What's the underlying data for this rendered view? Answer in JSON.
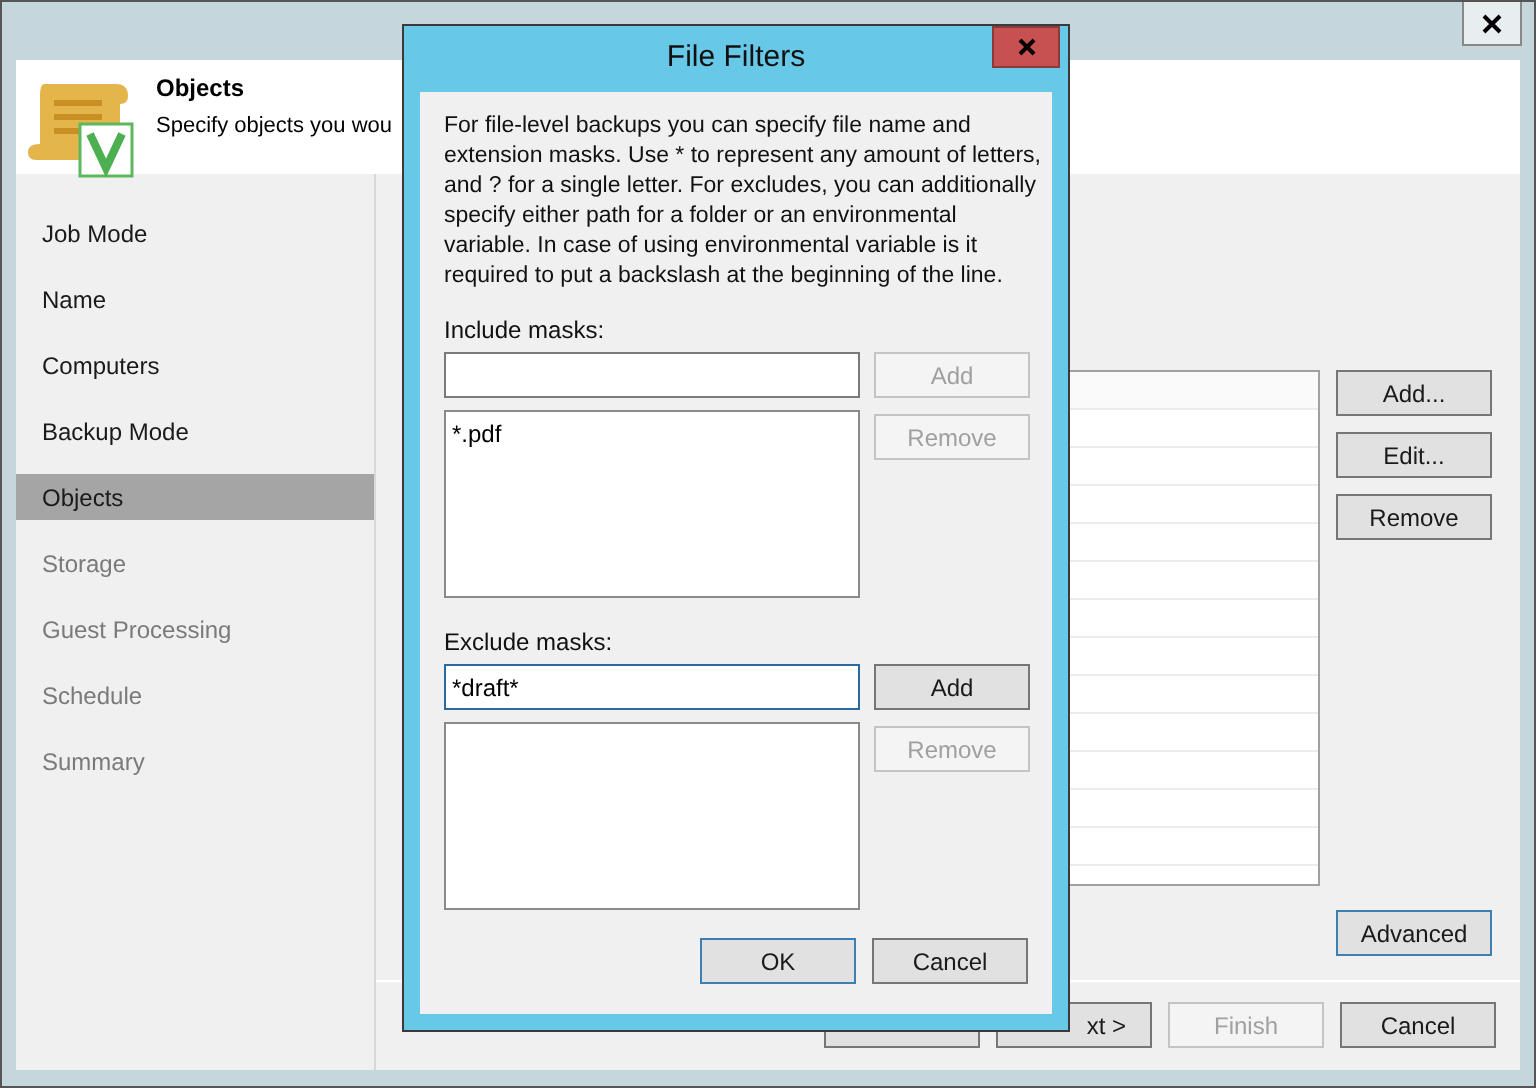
{
  "header": {
    "title": "Objects",
    "subtitle": "Specify objects you wou"
  },
  "nav": [
    {
      "label": "Job Mode",
      "selected": false,
      "disabled": false
    },
    {
      "label": "Name",
      "selected": false,
      "disabled": false
    },
    {
      "label": "Computers",
      "selected": false,
      "disabled": false
    },
    {
      "label": "Backup Mode",
      "selected": false,
      "disabled": false
    },
    {
      "label": "Objects",
      "selected": true,
      "disabled": false
    },
    {
      "label": "Storage",
      "selected": false,
      "disabled": true
    },
    {
      "label": "Guest Processing",
      "selected": false,
      "disabled": true
    },
    {
      "label": "Schedule",
      "selected": false,
      "disabled": true
    },
    {
      "label": "Summary",
      "selected": false,
      "disabled": true
    }
  ],
  "object_buttons": [
    {
      "label": "Add...",
      "disabled": false
    },
    {
      "label": "Edit...",
      "disabled": false
    },
    {
      "label": "Remove",
      "disabled": false
    }
  ],
  "advanced_button": {
    "label": "Advanced",
    "default": true
  },
  "footer_buttons": [
    {
      "disabled": false
    },
    {
      "label": "xt >",
      "disabled": false
    },
    {
      "label": "Finish",
      "disabled": true
    },
    {
      "label": "Cancel",
      "disabled": false
    }
  ],
  "dialog": {
    "title": "File Filters",
    "description": "For file-level backups you can specify file name and extension masks. Use * to represent any amount of letters, and ? for a single letter. For excludes, you can additionally specify either path for a folder or an environmental variable. In case of using environmental variable is it required to put a backslash at the beginning of the line.",
    "sections": [
      {
        "label": "Include masks:",
        "focused": false,
        "add": {
          "label": "Add",
          "disabled": true
        },
        "remove": {
          "label": "Remove",
          "disabled": true
        },
        "items": [
          "*.pdf"
        ]
      },
      {
        "label": "Exclude masks:",
        "value": "*draft*",
        "focused": true,
        "add": {
          "label": "Add",
          "disabled": false
        },
        "remove": {
          "label": "Remove",
          "disabled": true
        }
      }
    ],
    "buttons": [
      {
        "label": "OK",
        "default": true
      },
      {
        "label": "Cancel",
        "default": false
      }
    ]
  }
}
